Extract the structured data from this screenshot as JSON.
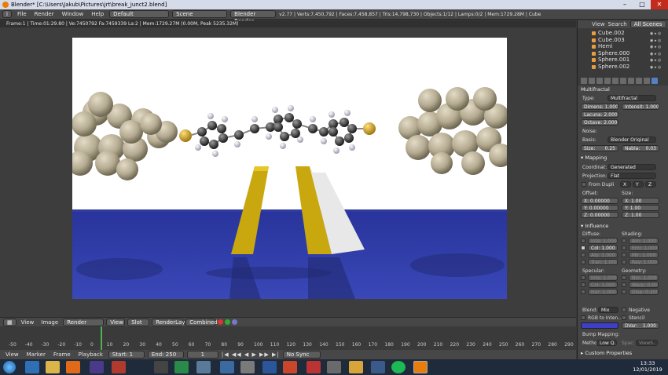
{
  "window": {
    "title": "Blender* [C:\\Users\\Jakub\\Pictures\\jrt\\break_junct2.blend]"
  },
  "menu": {
    "file": "File",
    "render": "Render",
    "window": "Window",
    "help": "Help",
    "layout": "Default",
    "scene": "Scene",
    "engine": "Blender Render",
    "stats": "v2.77 | Verts:7,450,792 | Faces:7,458,857 | Tris:14,798,730 | Objects:1/12 | Lamps:0/2 | Mem:1729.28M | Cube"
  },
  "image_editor": {
    "info": "Frame:1 | Time:01:29.80 | Ve:7450792 Fa:7459339 La:2 | Mem:1729.27M (0.00M, Peak 5235.32M)",
    "view": "View",
    "image": "Image",
    "image_name": "Render Result",
    "view2": "View",
    "slot": "Slot 1",
    "layer": "RenderLayer",
    "pass": "Combined"
  },
  "outliner": {
    "tabs": [
      "View",
      "Search",
      "All Scenes"
    ],
    "items": [
      "Cube.002",
      "Cube.003",
      "Hemi",
      "Sphere.000",
      "Sphere.001",
      "Sphere.002"
    ]
  },
  "properties": {
    "section_top": "Multifractal",
    "type_label": "Type:",
    "type_value": "Multifractal",
    "dimens": "Dimens: 1.000",
    "intensity": "Intensit: 1.000",
    "lacuna": "Lacuna: 2.000",
    "octaves": "Octave: 2.000",
    "noise_label": "Noise:",
    "basis_label": "Basis:",
    "basis_value": "Blender Original",
    "size": "Size:",
    "size_val": "0.25",
    "nabla": "Nabla:",
    "nabla_val": "0.03",
    "mapping": "Mapping",
    "coord_label": "Coordinat:",
    "coord_value": "Generated",
    "proj_label": "Projection:",
    "proj_value": "Flat",
    "from_dupli": "From Dupli",
    "axes": [
      "X",
      "Y",
      "Z"
    ],
    "offset_label": "Offset:",
    "size_label2": "Size:",
    "offset": [
      "X: 0.00000",
      "Y: 0.00000",
      "Z: 0.00000"
    ],
    "sizes": [
      "X: 1.00",
      "Y: 1.00",
      "Z: 1.00"
    ],
    "influence": "Influence",
    "diffuse": "Diffuse:",
    "shading": "Shading:",
    "diff_items": [
      "Inte: 1.000",
      "Col: 1.000",
      "Alp: 1.000",
      "Tran: 1.000"
    ],
    "shad_items": [
      "Am: 1.000",
      "Emi: 1.000",
      "Mir: 1.000",
      "Ray: 1.000"
    ],
    "specular": "Specular:",
    "geometry": "Geometry:",
    "spec_items": [
      "Inte: 1.000",
      "Col: 1.000",
      "Har: 1.000"
    ],
    "geo_items": [
      "Nor: 1.000",
      "Warp: 0.000",
      "Disp: 0.200"
    ],
    "blend_label": "Blend:",
    "blend_value": "Mix",
    "negative": "Negative",
    "rgb": "RGB to Inten...",
    "stencil": "Stencil",
    "dvar": "DVar:",
    "dvar_val": "1.000",
    "bump": "Bump Mapping:",
    "method": "Metho:",
    "method_val": "Low Q...",
    "space": "Spac:",
    "space_val": "ViewS...",
    "custom": "Custom Properties"
  },
  "timeline": {
    "ticks": [
      "-50",
      "-40",
      "-30",
      "-20",
      "-10",
      "0",
      "10",
      "20",
      "30",
      "40",
      "50",
      "60",
      "70",
      "80",
      "90",
      "100",
      "110",
      "120",
      "130",
      "140",
      "150",
      "160",
      "170",
      "180",
      "190",
      "200",
      "210",
      "220",
      "230",
      "240",
      "250",
      "260",
      "270",
      "280",
      "290"
    ],
    "view": "View",
    "marker": "Marker",
    "frame": "Frame",
    "playback": "Playback",
    "start": "Start:",
    "start_val": "1",
    "end": "End:",
    "end_val": "250",
    "current": "1",
    "sync": "No Sync"
  },
  "clock": {
    "time": "13:33",
    "date": "12/01/2019"
  }
}
